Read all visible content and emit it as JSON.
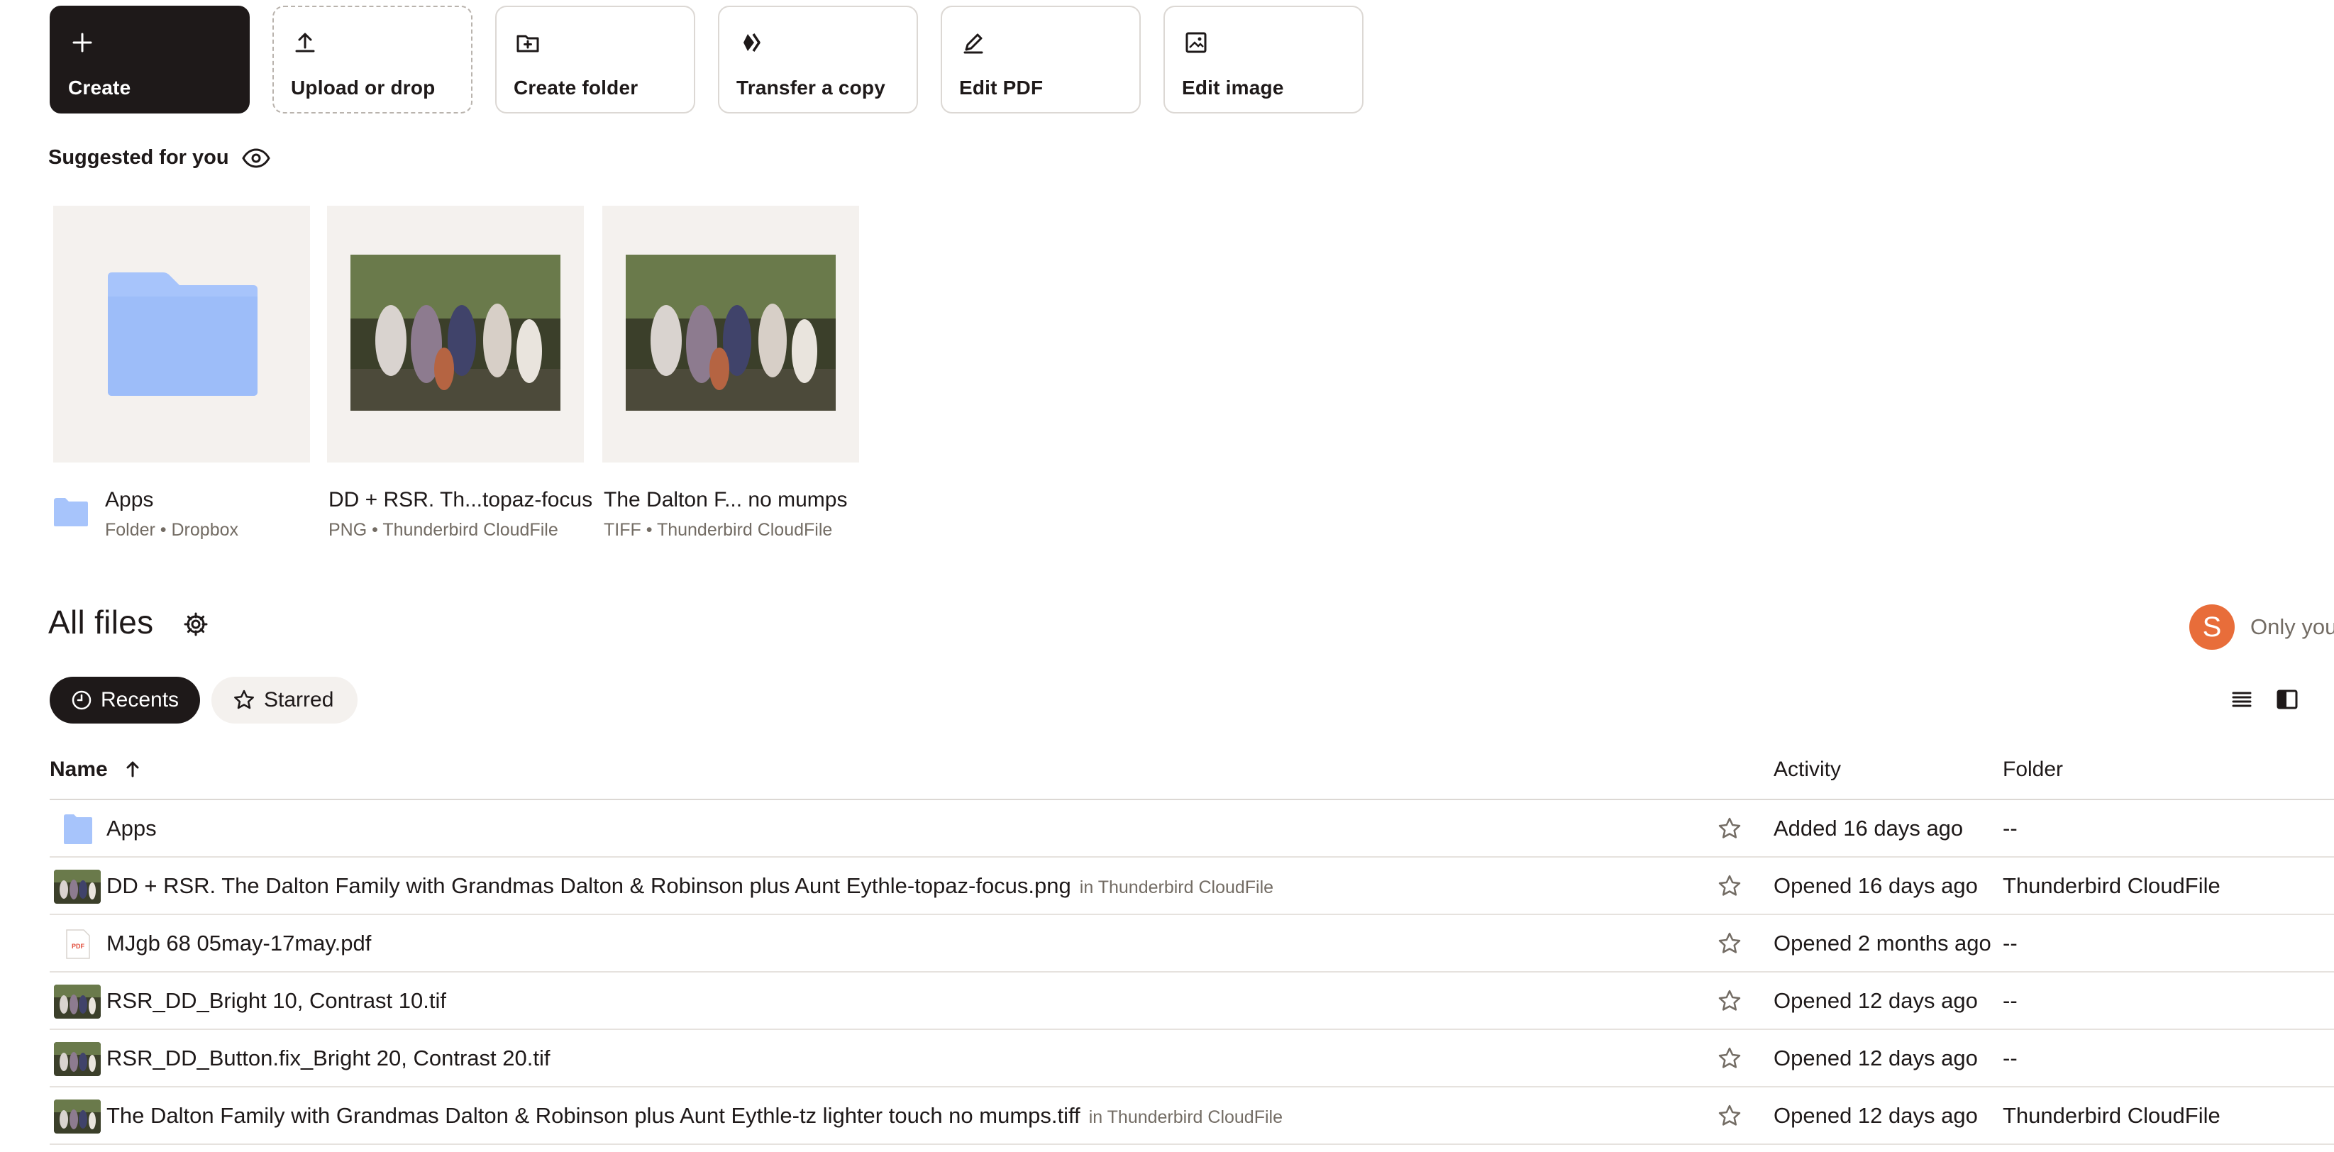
{
  "actions": [
    {
      "label": "Create",
      "icon": "plus-icon"
    },
    {
      "label": "Upload or drop",
      "icon": "upload-icon"
    },
    {
      "label": "Create folder",
      "icon": "folder-plus-icon"
    },
    {
      "label": "Transfer a copy",
      "icon": "transfer-icon"
    },
    {
      "label": "Edit PDF",
      "icon": "pen-icon"
    },
    {
      "label": "Edit image",
      "icon": "image-edit-icon"
    }
  ],
  "suggested": {
    "title": "Suggested for you",
    "cards": [
      {
        "name": "Apps",
        "meta": "Folder • Dropbox",
        "kind": "folder"
      },
      {
        "name": "DD + RSR. Th...topaz-focus",
        "meta": "PNG • Thunderbird CloudFile",
        "kind": "photo"
      },
      {
        "name": "The Dalton F... no mumps",
        "meta": "TIFF • Thunderbird CloudFile",
        "kind": "photo"
      }
    ]
  },
  "all_files": {
    "title": "All files",
    "avatar_initial": "S",
    "sharing": "Only you",
    "filters": [
      {
        "label": "Recents",
        "active": true
      },
      {
        "label": "Starred",
        "active": false
      }
    ],
    "columns": {
      "name": "Name",
      "activity": "Activity",
      "folder": "Folder"
    },
    "rows": [
      {
        "name": "Apps",
        "location": "",
        "activity": "Added 16 days ago",
        "folder": "--",
        "kind": "folder"
      },
      {
        "name": "DD + RSR. The Dalton Family with Grandmas Dalton & Robinson plus Aunt Eythle-topaz-focus.png",
        "location": "in Thunderbird CloudFile",
        "activity": "Opened 16 days ago",
        "folder": "Thunderbird CloudFile",
        "kind": "photo"
      },
      {
        "name": "MJgb 68 05may-17may.pdf",
        "location": "",
        "activity": "Opened 2 months ago",
        "folder": "--",
        "kind": "pdf"
      },
      {
        "name": "RSR_DD_Bright 10, Contrast 10.tif",
        "location": "",
        "activity": "Opened 12 days ago",
        "folder": "--",
        "kind": "photo"
      },
      {
        "name": "RSR_DD_Button.fix_Bright 20, Contrast 20.tif",
        "location": "",
        "activity": "Opened 12 days ago",
        "folder": "--",
        "kind": "photo"
      },
      {
        "name": "The Dalton Family with Grandmas Dalton & Robinson plus Aunt Eythle-tz lighter touch no mumps.tiff",
        "location": "in Thunderbird CloudFile",
        "activity": "Opened 12 days ago",
        "folder": "Thunderbird CloudFile",
        "kind": "photo"
      }
    ]
  },
  "colors": {
    "accent_dark": "#1e1919",
    "folder_blue": "#a7c4fb",
    "avatar": "#e86d3a",
    "muted": "#736c64"
  }
}
